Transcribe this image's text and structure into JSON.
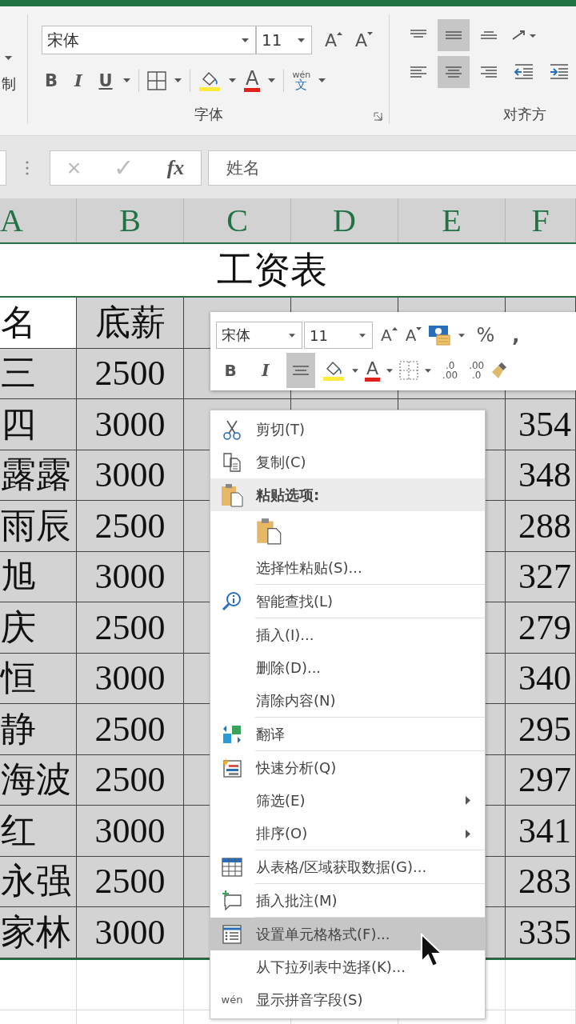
{
  "ribbon": {
    "clipboard_fragment": "制",
    "font": {
      "name": "宋体",
      "size": "11",
      "grow": "A",
      "shrink": "A",
      "bold": "B",
      "italic": "I",
      "underline": "U",
      "font_color": "A",
      "phonetic_top": "wén",
      "phonetic_bottom": "文",
      "label": "字体"
    },
    "alignment": {
      "label": "对齐方",
      "row1": [
        {
          "kind": "top",
          "selected": false
        },
        {
          "kind": "middle",
          "selected": true
        },
        {
          "kind": "bottom",
          "selected": false
        },
        {
          "kind": "orientation",
          "selected": false
        }
      ],
      "row2": [
        {
          "kind": "left",
          "selected": false
        },
        {
          "kind": "center",
          "selected": true
        },
        {
          "kind": "right",
          "selected": false
        },
        {
          "kind": "indent-decrease",
          "selected": false
        },
        {
          "kind": "indent-increase",
          "selected": false
        }
      ]
    }
  },
  "formula_bar": {
    "cancel": "×",
    "enter": "✓",
    "fx": "fx",
    "value": "姓名"
  },
  "sheet": {
    "columns": [
      {
        "label": "A",
        "selected": true
      },
      {
        "label": "B",
        "selected": true
      },
      {
        "label": "C",
        "selected": true
      },
      {
        "label": "D",
        "selected": true
      },
      {
        "label": "E",
        "selected": true
      },
      {
        "label": "F",
        "selected": true
      }
    ],
    "title": "工资表",
    "rows": [
      {
        "name": "名",
        "base": "底薪",
        "selected": true,
        "active": true
      },
      {
        "name": "三",
        "base": "2500",
        "selected": true,
        "active": false
      },
      {
        "name": "四",
        "base": "3000",
        "col_f": "354",
        "selected": true,
        "active": false
      },
      {
        "name": "露露",
        "base": "3000",
        "col_f": "348",
        "selected": true,
        "active": false
      },
      {
        "name": "雨辰",
        "base": "2500",
        "col_f": "288",
        "selected": true,
        "active": false
      },
      {
        "name": "旭",
        "base": "3000",
        "col_f": "327",
        "selected": true,
        "active": false
      },
      {
        "name": "庆",
        "base": "2500",
        "col_f": "279",
        "selected": true,
        "active": false
      },
      {
        "name": "恒",
        "base": "3000",
        "col_f": "340",
        "selected": true,
        "active": false
      },
      {
        "name": "静",
        "base": "2500",
        "col_f": "295",
        "selected": true,
        "active": false
      },
      {
        "name": "海波",
        "base": "2500",
        "col_f": "297",
        "selected": true,
        "active": false
      },
      {
        "name": "红",
        "base": "3000",
        "col_f": "341",
        "selected": true,
        "active": false
      },
      {
        "name": "永强",
        "base": "2500",
        "col_f": "283",
        "selected": true,
        "active": false
      },
      {
        "name": "家林",
        "base": "3000",
        "col_f": "335",
        "selected": true,
        "active": false
      }
    ]
  },
  "mini_toolbar": {
    "font_name": "宋体",
    "font_size": "11",
    "grow": "A",
    "shrink": "A",
    "percent": "%",
    "comma": ",",
    "bold": "B",
    "italic": "I",
    "center_selected": true,
    "font_color": "A",
    "inc_decimal_top": ".0",
    "inc_decimal_bottom": ".00",
    "dec_decimal_top": ".00",
    "dec_decimal_bottom": ".0"
  },
  "context_menu": {
    "items": [
      {
        "kind": "item",
        "label": "剪切(T)",
        "submenu": false,
        "selected": false,
        "separator_after": false
      },
      {
        "kind": "item",
        "label": "复制(C)",
        "submenu": false,
        "selected": false,
        "separator_after": false
      },
      {
        "kind": "header",
        "label": "粘贴选项:",
        "submenu": false,
        "selected": false,
        "separator_after": false
      },
      {
        "kind": "paste-buttons",
        "selected": false
      },
      {
        "kind": "item",
        "label": "选择性粘贴(S)...",
        "submenu": false,
        "selected": false,
        "separator_after": true
      },
      {
        "kind": "item",
        "label": "智能查找(L)",
        "submenu": false,
        "selected": false,
        "separator_after": true
      },
      {
        "kind": "item",
        "label": "插入(I)...",
        "submenu": false,
        "selected": false,
        "separator_after": false
      },
      {
        "kind": "item",
        "label": "删除(D)...",
        "submenu": false,
        "selected": false,
        "separator_after": false
      },
      {
        "kind": "item",
        "label": "清除内容(N)",
        "submenu": false,
        "selected": false,
        "separator_after": true
      },
      {
        "kind": "item",
        "label": "翻译",
        "submenu": false,
        "selected": false,
        "separator_after": true
      },
      {
        "kind": "item",
        "label": "快速分析(Q)",
        "submenu": false,
        "selected": false,
        "separator_after": false
      },
      {
        "kind": "item",
        "label": "筛选(E)",
        "submenu": true,
        "selected": false,
        "separator_after": false
      },
      {
        "kind": "item",
        "label": "排序(O)",
        "submenu": true,
        "selected": false,
        "separator_after": true
      },
      {
        "kind": "item",
        "label": "从表格/区域获取数据(G)...",
        "submenu": false,
        "selected": false,
        "separator_after": true
      },
      {
        "kind": "item",
        "label": "插入批注(M)",
        "submenu": false,
        "selected": false,
        "separator_after": true
      },
      {
        "kind": "item",
        "label": "设置单元格格式(F)...",
        "submenu": false,
        "selected": true,
        "separator_after": false
      },
      {
        "kind": "item",
        "label": "从下拉列表中选择(K)...",
        "submenu": false,
        "selected": false,
        "separator_after": false
      },
      {
        "kind": "item",
        "label": "显示拼音字段(S)",
        "icon_text": "wén",
        "submenu": false,
        "selected": false,
        "separator_after": false
      }
    ]
  }
}
